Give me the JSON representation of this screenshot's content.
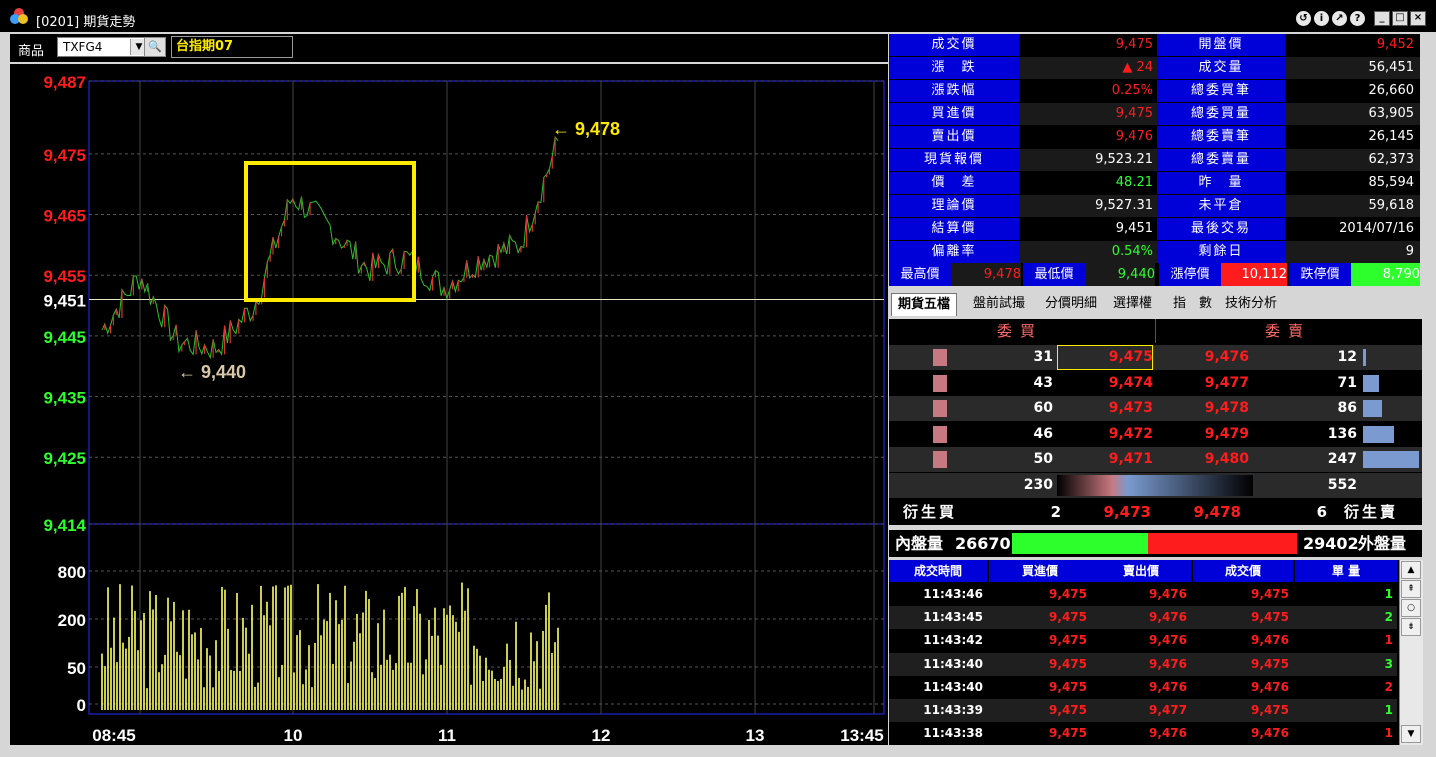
{
  "window": {
    "title": "[0201] 期貨走勢"
  },
  "toolbar": {
    "product_label": "商品",
    "product_code": "TXFG4",
    "product_name": "台指期07"
  },
  "chart": {
    "y_ticks": [
      {
        "label": "9,487",
        "v": 9487,
        "color": "red"
      },
      {
        "label": "9,475",
        "v": 9475,
        "color": "red"
      },
      {
        "label": "9,465",
        "v": 9465,
        "color": "red"
      },
      {
        "label": "9,455",
        "v": 9455,
        "color": "red"
      },
      {
        "label": "9,451",
        "v": 9451,
        "color": "white"
      },
      {
        "label": "9,445",
        "v": 9445,
        "color": "green"
      },
      {
        "label": "9,435",
        "v": 9435,
        "color": "green"
      },
      {
        "label": "9,425",
        "v": 9425,
        "color": "green"
      },
      {
        "label": "9,414",
        "v": 9414,
        "color": "green"
      }
    ],
    "vol_ticks": [
      "800",
      "200",
      "50",
      "0"
    ],
    "x_ticks": [
      "08:45",
      "10",
      "11",
      "12",
      "13",
      "13:45"
    ],
    "high_annotation": "← 9,478",
    "low_annotation": "← 9,440",
    "reference_price": 9451,
    "price_range": [
      9414,
      9487
    ]
  },
  "chart_data": {
    "type": "line",
    "title": "",
    "xlabel": "",
    "ylabel": "",
    "x": [
      "08:45",
      "09:00",
      "09:15",
      "09:30",
      "09:45",
      "10:00",
      "10:15",
      "10:30",
      "10:45",
      "11:00",
      "11:15",
      "11:30",
      "11:45"
    ],
    "series": [
      {
        "values": [
          9446,
          9455,
          9444,
          9443,
          9450,
          9468,
          9463,
          9456,
          9458,
          9453,
          9458,
          9460,
          9477
        ]
      }
    ],
    "ylim": [
      9414,
      9487
    ],
    "reference_line": 9451,
    "high": 9478,
    "low": 9440,
    "grid": true
  },
  "quote": {
    "rows": [
      {
        "l1": "成交價",
        "v1": "9,475",
        "c1": "red",
        "l2": "開盤價",
        "v2": "9,452",
        "c2": "red"
      },
      {
        "l1": "漲　跌",
        "v1": "▲ 24",
        "c1": "red",
        "l2": "成交量",
        "v2": "56,451",
        "c2": "white"
      },
      {
        "l1": "漲跌幅",
        "v1": "0.25%",
        "c1": "red",
        "l2": "總委買筆",
        "v2": "26,660",
        "c2": "white"
      },
      {
        "l1": "買進價",
        "v1": "9,475",
        "c1": "red",
        "l2": "總委買量",
        "v2": "63,905",
        "c2": "white"
      },
      {
        "l1": "賣出價",
        "v1": "9,476",
        "c1": "red",
        "l2": "總委賣筆",
        "v2": "26,145",
        "c2": "white"
      },
      {
        "l1": "現貨報價",
        "v1": "9,523.21",
        "c1": "white",
        "l2": "總委賣量",
        "v2": "62,373",
        "c2": "white"
      },
      {
        "l1": "價　差",
        "v1": "48.21",
        "c1": "green",
        "l2": "昨　量",
        "v2": "85,594",
        "c2": "white"
      },
      {
        "l1": "理論價",
        "v1": "9,527.31",
        "c1": "white",
        "l2": "未平倉",
        "v2": "59,618",
        "c2": "white"
      },
      {
        "l1": "結算價",
        "v1": "9,451",
        "c1": "white",
        "l2": "最後交易",
        "v2": "2014/07/16",
        "c2": "white"
      },
      {
        "l1": "偏離率",
        "v1": "0.54%",
        "c1": "green",
        "l2": "剩餘日",
        "v2": "9",
        "c2": "white"
      }
    ]
  },
  "hilo": {
    "high_label": "最高價",
    "high": "9,478",
    "low_label": "最低價",
    "low": "9,440",
    "limit_up_label": "漲停價",
    "limit_up": "10,112",
    "limit_down_label": "跌停價",
    "limit_down": "8,790"
  },
  "tabs": [
    "期貨五檔",
    "盤前試撮",
    "分價明細",
    "選擇權",
    "指　數",
    "技術分析"
  ],
  "book": {
    "bid_header": "委買",
    "ask_header": "委賣",
    "levels": [
      {
        "bid_qty": "31",
        "bid": "9,475",
        "ask": "9,476",
        "ask_qty": "12",
        "bq": 31,
        "aq": 12
      },
      {
        "bid_qty": "43",
        "bid": "9,474",
        "ask": "9,477",
        "ask_qty": "71",
        "bq": 43,
        "aq": 71
      },
      {
        "bid_qty": "60",
        "bid": "9,473",
        "ask": "9,478",
        "ask_qty": "86",
        "bq": 60,
        "aq": 86
      },
      {
        "bid_qty": "46",
        "bid": "9,472",
        "ask": "9,479",
        "ask_qty": "136",
        "bq": 46,
        "aq": 136
      },
      {
        "bid_qty": "50",
        "bid": "9,471",
        "ask": "9,480",
        "ask_qty": "247",
        "bq": 50,
        "aq": 247
      }
    ],
    "bid_total": "230",
    "ask_total": "552"
  },
  "derivative": {
    "buy_label": "衍生買",
    "buy_qty": "2",
    "buy_price": "9,473",
    "sell_price": "9,478",
    "sell_qty": "6",
    "sell_label": "衍生賣"
  },
  "volume_split": {
    "inner_label": "內盤量",
    "inner": "26670",
    "outer": "29402",
    "outer_label": "外盤量",
    "inner_fraction": 0.476
  },
  "trades": {
    "headers": [
      "成交時間",
      "買進價",
      "賣出價",
      "成交價",
      "單 量"
    ],
    "rows": [
      [
        "11:43:46",
        "9,475",
        "9,476",
        "9,475",
        "1"
      ],
      [
        "11:43:45",
        "9,475",
        "9,476",
        "9,475",
        "2"
      ],
      [
        "11:43:42",
        "9,475",
        "9,476",
        "9,476",
        "1"
      ],
      [
        "11:43:40",
        "9,475",
        "9,476",
        "9,475",
        "3"
      ],
      [
        "11:43:40",
        "9,475",
        "9,476",
        "9,476",
        "2"
      ],
      [
        "11:43:39",
        "9,475",
        "9,477",
        "9,475",
        "1"
      ],
      [
        "11:43:38",
        "9,475",
        "9,476",
        "9,476",
        "1"
      ]
    ]
  }
}
